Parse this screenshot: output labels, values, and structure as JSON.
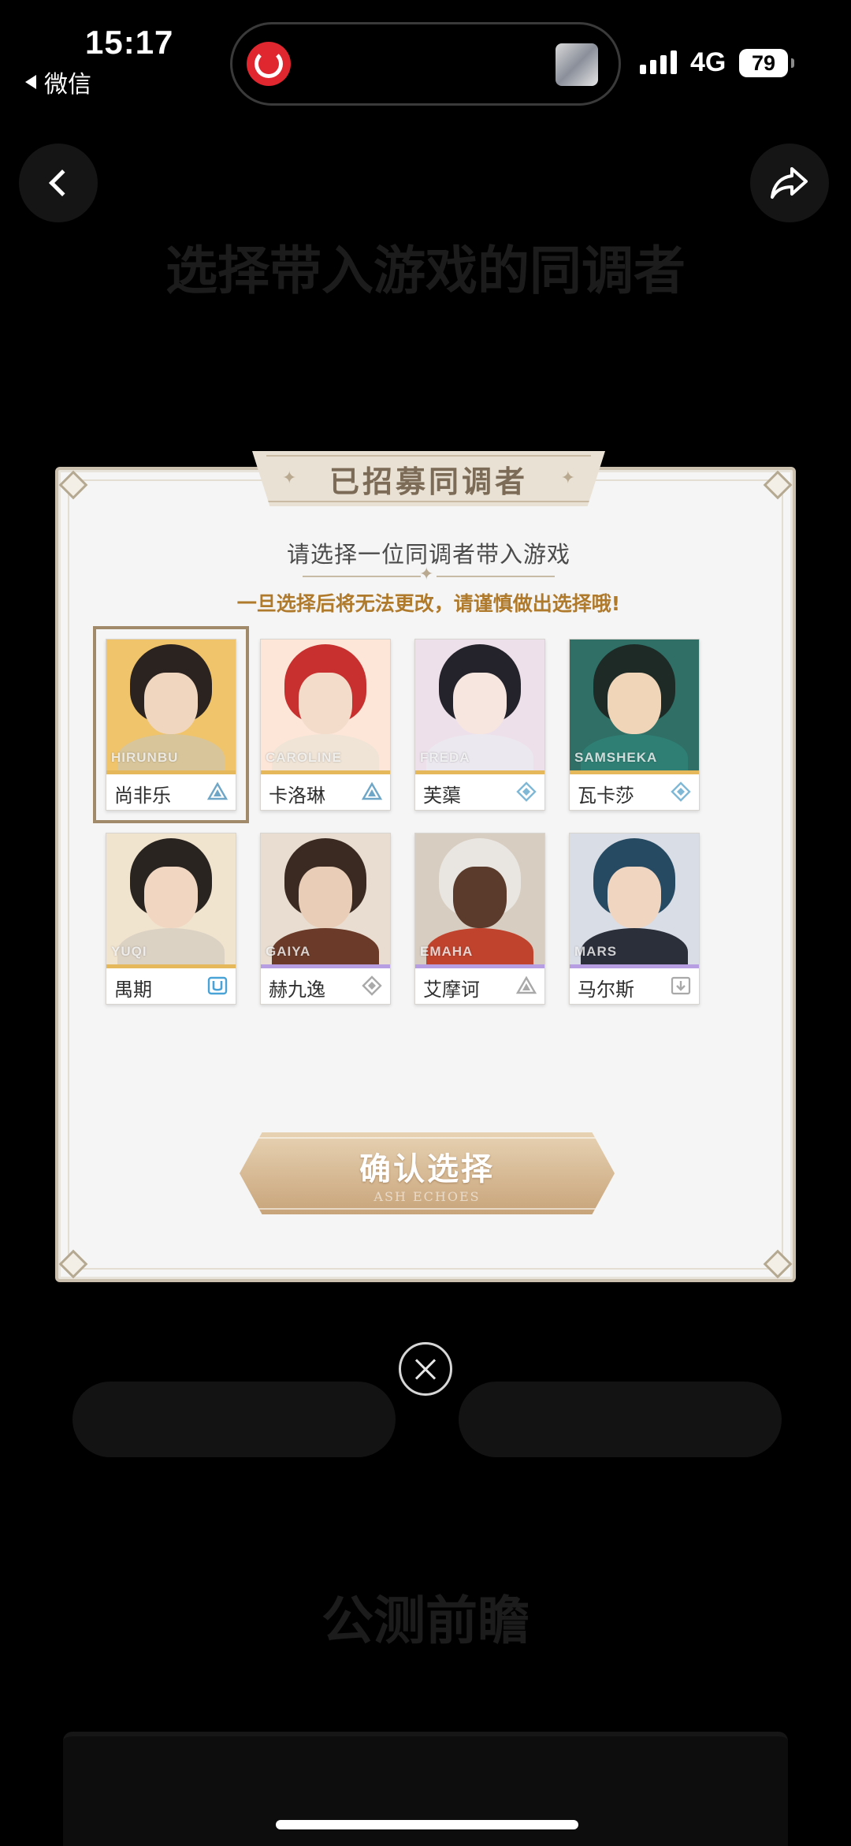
{
  "status_bar": {
    "time": "15:17",
    "back_app": "微信",
    "network": "4G",
    "battery": "79"
  },
  "background": {
    "title": "选择带入游戏的同调者",
    "pill_left": "",
    "pill_right": "",
    "heading": "公测前瞻"
  },
  "modal": {
    "banner_title": "已招募同调者",
    "subtitle": "请选择一位同调者带入游戏",
    "warning": "一旦选择后将无法更改，请谨慎做出选择哦!",
    "confirm_label": "确认选择",
    "confirm_sub": "ASH ECHOES",
    "characters": [
      {
        "name": "尚非乐",
        "roman": "HIRUNBU",
        "element_icon": "triangle-element-icon",
        "rarity_color": "#e5b85c",
        "hair": "#2b2320",
        "skin": "#f1d6bf",
        "body": "#d8c59a",
        "bg": "#f0c46a",
        "elem_color": "#6ea6c7"
      },
      {
        "name": "卡洛琳",
        "roman": "CAROLINE",
        "element_icon": "triangle-element-icon",
        "rarity_color": "#e5b85c",
        "hair": "#c7302e",
        "skin": "#f4dccb",
        "body": "#efe4d6",
        "bg": "#fde6d8",
        "elem_color": "#6ea6c7"
      },
      {
        "name": "芙蕖",
        "roman": "FREDA",
        "element_icon": "diamond-element-icon",
        "rarity_color": "#e5b85c",
        "hair": "#24222b",
        "skin": "#f6e6df",
        "body": "#ece8ef",
        "bg": "#ede0ea",
        "elem_color": "#7fb8d6"
      },
      {
        "name": "瓦卡莎",
        "roman": "SAMSHEKA",
        "element_icon": "diamond-element-icon",
        "rarity_color": "#e5b85c",
        "hair": "#1d2a26",
        "skin": "#f1d5b8",
        "body": "#2f7f74",
        "bg": "#2f6f66",
        "elem_color": "#7fb8d6"
      },
      {
        "name": "禺期",
        "roman": "YUQI",
        "element_icon": "bracket-element-icon",
        "rarity_color": "#e5b85c",
        "hair": "#2a2420",
        "skin": "#f1d7c2",
        "body": "#dcd2c4",
        "bg": "#f1e4cf",
        "elem_color": "#4aa3d6"
      },
      {
        "name": "赫九逸",
        "roman": "GAIYA",
        "element_icon": "diamond-element-icon",
        "rarity_color": "#b79de2",
        "hair": "#3a2a22",
        "skin": "#e9cdb6",
        "body": "#6b3a28",
        "bg": "#e8ddd0",
        "elem_color": "#a9a9a9"
      },
      {
        "name": "艾摩诃",
        "roman": "EMAHA",
        "element_icon": "triangle-element-icon",
        "rarity_color": "#b79de2",
        "hair": "#e9e6e1",
        "skin": "#5a3b2c",
        "body": "#c0432d",
        "bg": "#d8cdc1",
        "elem_color": "#a9a9a9"
      },
      {
        "name": "马尔斯",
        "roman": "MARS",
        "element_icon": "arrow-down-element-icon",
        "rarity_color": "#b79de2",
        "hair": "#274a63",
        "skin": "#f0d5c0",
        "body": "#2b2f3a",
        "bg": "#d9dde6",
        "elem_color": "#a9a9a9"
      }
    ]
  }
}
